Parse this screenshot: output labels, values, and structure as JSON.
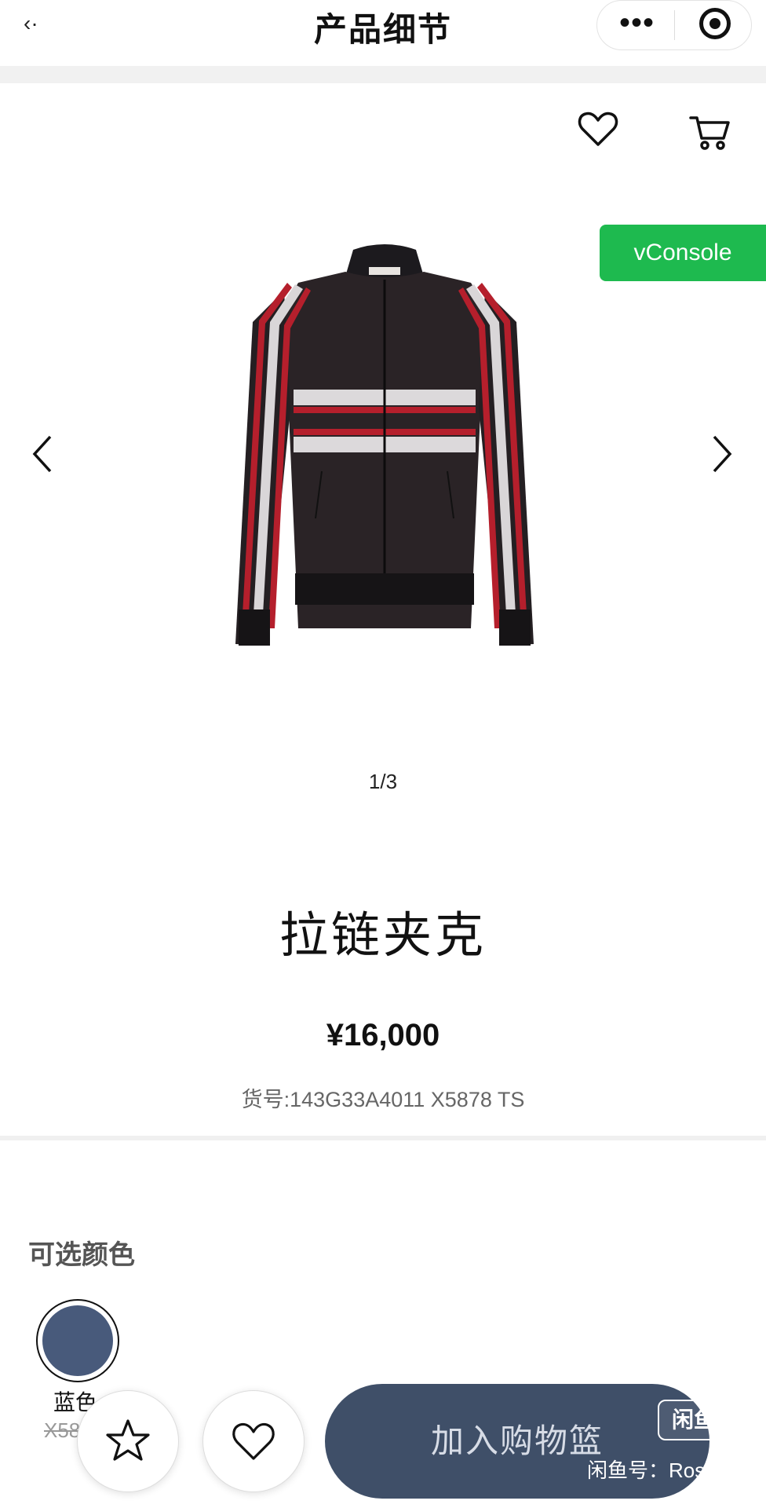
{
  "nav": {
    "back_glyph": "‹·",
    "title": "产品细节",
    "more_glyph": "•••"
  },
  "gallery": {
    "pager": "1/3"
  },
  "debug": {
    "vconsole_label": "vConsole"
  },
  "product": {
    "name": "拉链夹克",
    "price": "¥16,000",
    "sku": "货号:143G33A4011 X5878 TS"
  },
  "colors": {
    "heading": "可选颜色",
    "options": [
      {
        "label": "蓝色",
        "sku_partial": "X58",
        "hex": "#485a7b"
      }
    ]
  },
  "actions": {
    "add_to_cart": "加入购物篮"
  },
  "watermark": {
    "logo": "闲鱼",
    "text": "闲鱼号：Rose"
  },
  "theme": {
    "accent": "#3f4f68",
    "vconsole_green": "#1eba4f"
  }
}
